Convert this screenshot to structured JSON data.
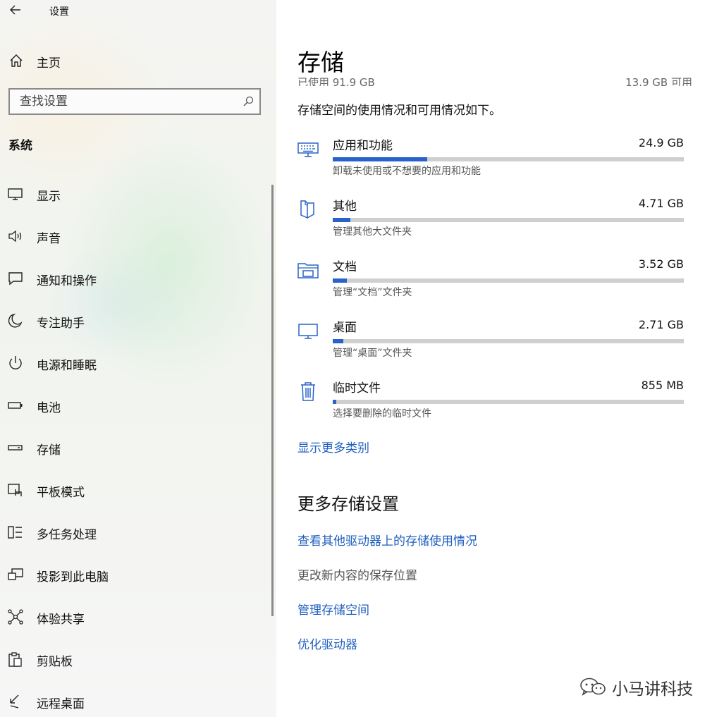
{
  "window": {
    "title": "设置"
  },
  "sidebar": {
    "home_label": "主页",
    "search": {
      "placeholder": "查找设置",
      "value": ""
    },
    "section_title": "系统",
    "items": [
      {
        "label": "显示",
        "icon": "display-icon"
      },
      {
        "label": "声音",
        "icon": "speaker-icon"
      },
      {
        "label": "通知和操作",
        "icon": "notification-icon"
      },
      {
        "label": "专注助手",
        "icon": "moon-icon"
      },
      {
        "label": "电源和睡眠",
        "icon": "power-icon"
      },
      {
        "label": "电池",
        "icon": "battery-icon"
      },
      {
        "label": "存储",
        "icon": "storage-icon"
      },
      {
        "label": "平板模式",
        "icon": "tablet-mode-icon"
      },
      {
        "label": "多任务处理",
        "icon": "multitasking-icon"
      },
      {
        "label": "投影到此电脑",
        "icon": "project-icon"
      },
      {
        "label": "体验共享",
        "icon": "share-icon"
      },
      {
        "label": "剪贴板",
        "icon": "clipboard-icon"
      },
      {
        "label": "远程桌面",
        "icon": "remote-desktop-icon"
      }
    ]
  },
  "main": {
    "title": "存储",
    "used_text": "已使用 91.9 GB",
    "free_text": "13.9 GB 可用",
    "subtitle": "存储空间的使用情况和可用情况如下。",
    "categories": [
      {
        "name": "应用和功能",
        "size": "24.9 GB",
        "desc": "卸载未使用或不想要的应用和功能",
        "fill_percent": 27,
        "icon": "keyboard-icon"
      },
      {
        "name": "其他",
        "size": "4.71 GB",
        "desc": "管理其他大文件夹",
        "fill_percent": 5,
        "icon": "other-folder-icon"
      },
      {
        "name": "文档",
        "size": "3.52 GB",
        "desc": "管理“文档”文件夹",
        "fill_percent": 4,
        "icon": "documents-folder-icon"
      },
      {
        "name": "桌面",
        "size": "2.71 GB",
        "desc": "管理“桌面”文件夹",
        "fill_percent": 3,
        "icon": "desktop-icon"
      },
      {
        "name": "临时文件",
        "size": "855 MB",
        "desc": "选择要删除的临时文件",
        "fill_percent": 1,
        "icon": "trash-icon"
      }
    ],
    "show_more_link": "显示更多类别",
    "more_settings": {
      "heading": "更多存储设置",
      "view_other_drives_link": "查看其他驱动器上的存储使用情况",
      "change_save_location": "更改新内容的保存位置",
      "manage_spaces_link": "管理存储空间",
      "optimize_drives_link": "优化驱动器"
    }
  },
  "watermark": {
    "text": "小马讲科技"
  },
  "colors": {
    "accent": "#2a62c9",
    "link": "#1f5fbf",
    "bar_track": "#cfcfcf"
  }
}
